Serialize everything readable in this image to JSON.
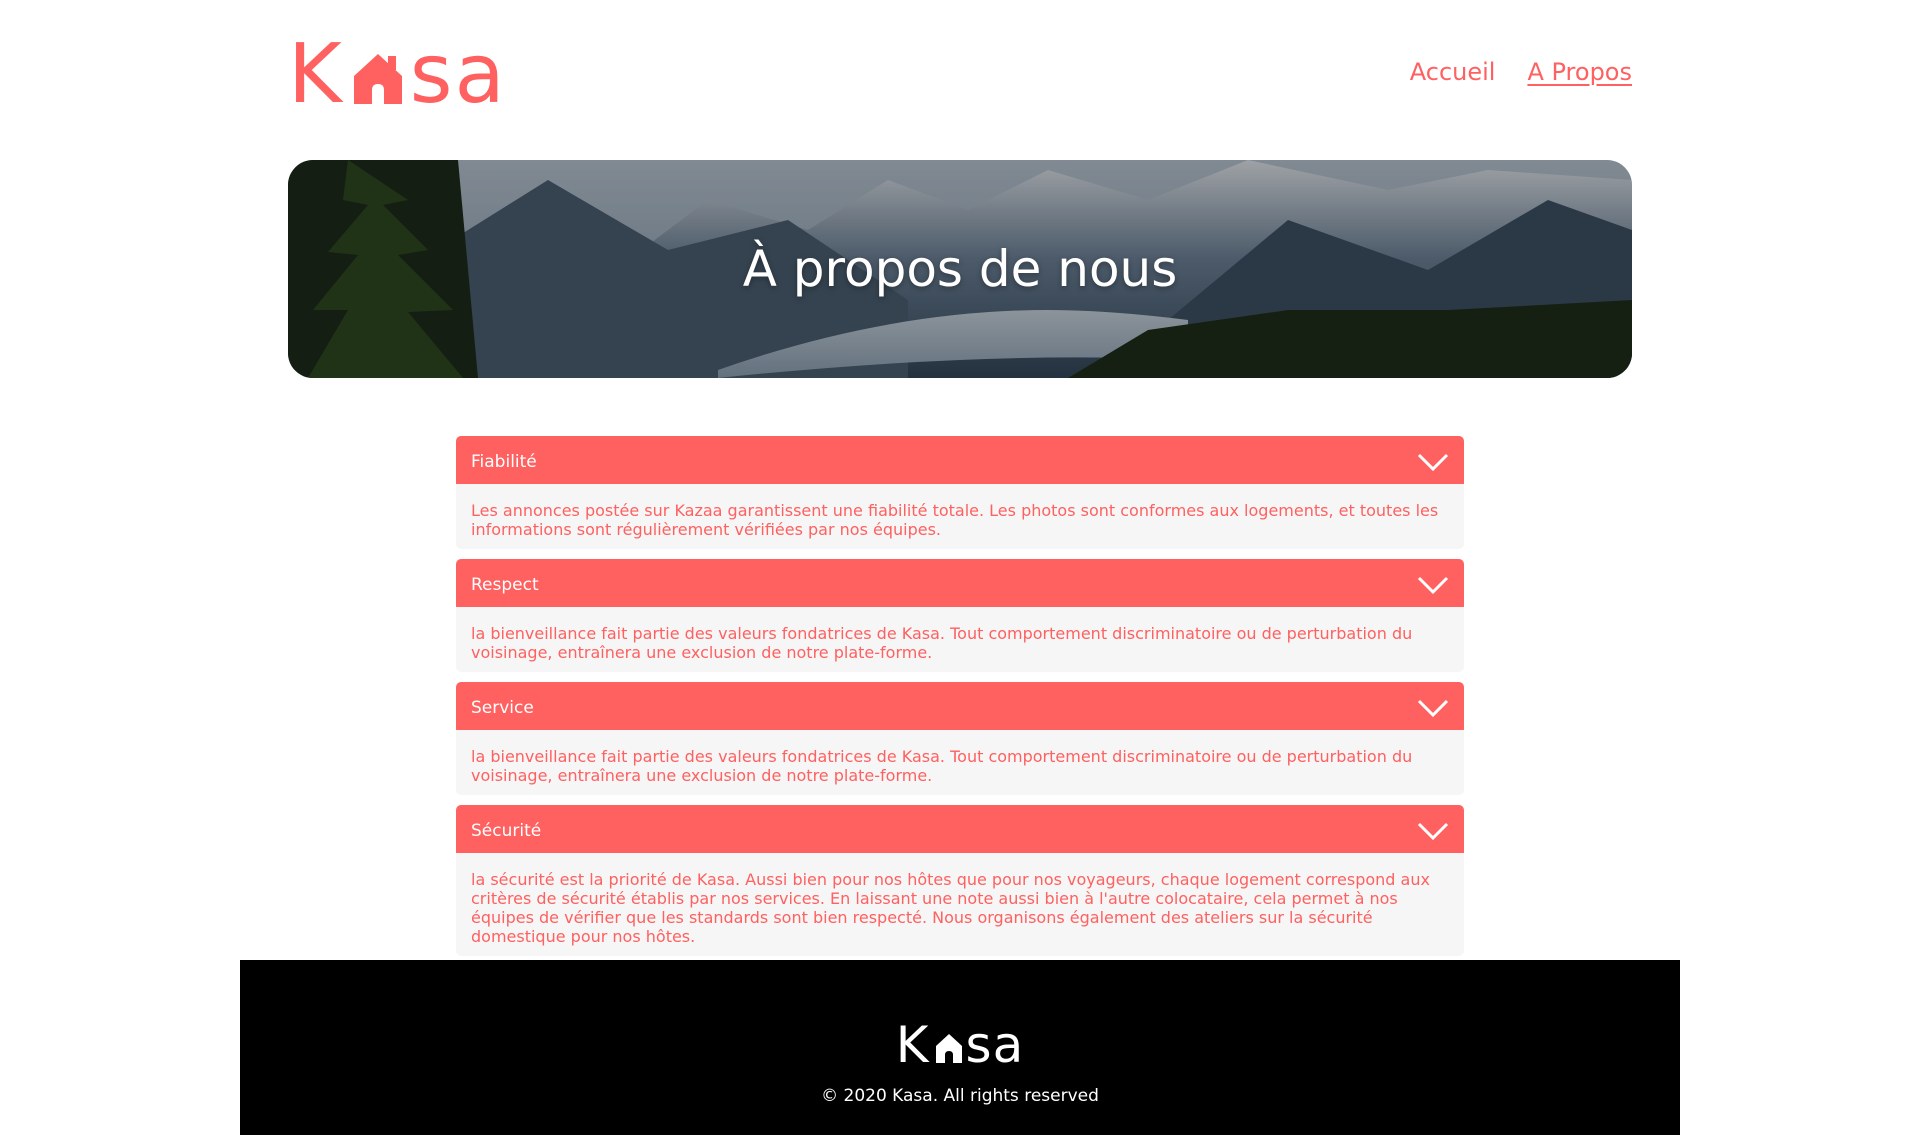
{
  "brand": {
    "logo_k": "K",
    "logo_rest": "sa",
    "accent_color": "#FF6060"
  },
  "nav": {
    "home_label": "Accueil",
    "about_label": "A Propos"
  },
  "banner": {
    "title": "À propos de nous"
  },
  "collapses": [
    {
      "title": "Fiabilité",
      "content": "Les annonces postée sur Kazaa garantissent une fiabilité totale. Les photos sont conformes aux logements, et toutes les informations sont régulièrement vérifiées par nos équipes."
    },
    {
      "title": "Respect",
      "content": "la bienveillance fait partie des valeurs fondatrices de Kasa. Tout comportement discriminatoire ou de perturbation du voisinage, entraînera une exclusion de notre plate-forme."
    },
    {
      "title": "Service",
      "content": "la bienveillance fait partie des valeurs fondatrices de Kasa. Tout comportement discriminatoire ou de perturbation du voisinage, entraînera une exclusion de notre plate-forme."
    },
    {
      "title": "Sécurité",
      "content": "la sécurité est la priorité de Kasa. Aussi bien pour nos hôtes que pour nos voyageurs, chaque logement correspond aux critères de sécurité établis par nos services. En laissant une note aussi bien à l'autre colocataire, cela permet à nos équipes de vérifier que les standards sont bien respecté. Nous organisons également des ateliers sur la sécurité domestique pour nos hôtes."
    }
  ],
  "footer": {
    "logo_k": "K",
    "logo_rest": "sa",
    "copyright": "© 2020 Kasa. All rights reserved"
  }
}
